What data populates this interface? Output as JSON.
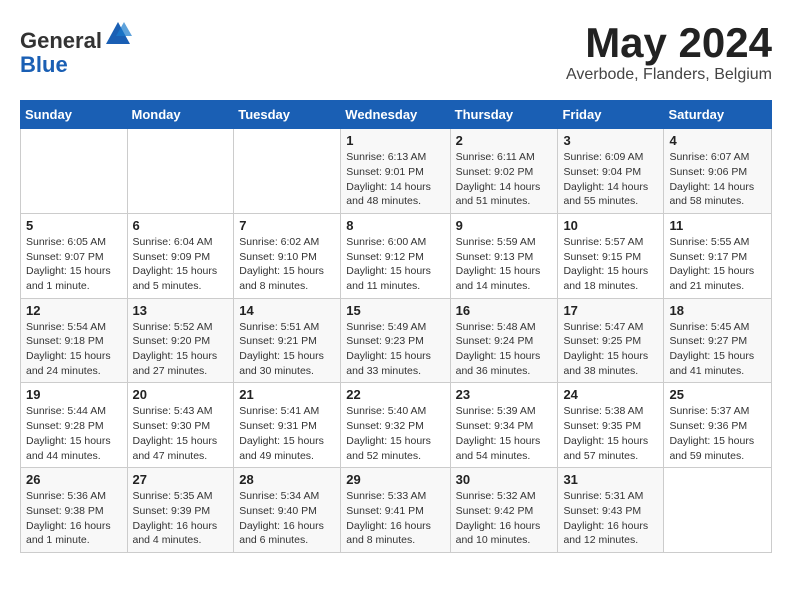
{
  "header": {
    "logo_line1": "General",
    "logo_line2": "Blue",
    "month_title": "May 2024",
    "location": "Averbode, Flanders, Belgium"
  },
  "days_of_week": [
    "Sunday",
    "Monday",
    "Tuesday",
    "Wednesday",
    "Thursday",
    "Friday",
    "Saturday"
  ],
  "weeks": [
    [
      {
        "day": "",
        "info": ""
      },
      {
        "day": "",
        "info": ""
      },
      {
        "day": "",
        "info": ""
      },
      {
        "day": "1",
        "info": "Sunrise: 6:13 AM\nSunset: 9:01 PM\nDaylight: 14 hours\nand 48 minutes."
      },
      {
        "day": "2",
        "info": "Sunrise: 6:11 AM\nSunset: 9:02 PM\nDaylight: 14 hours\nand 51 minutes."
      },
      {
        "day": "3",
        "info": "Sunrise: 6:09 AM\nSunset: 9:04 PM\nDaylight: 14 hours\nand 55 minutes."
      },
      {
        "day": "4",
        "info": "Sunrise: 6:07 AM\nSunset: 9:06 PM\nDaylight: 14 hours\nand 58 minutes."
      }
    ],
    [
      {
        "day": "5",
        "info": "Sunrise: 6:05 AM\nSunset: 9:07 PM\nDaylight: 15 hours\nand 1 minute."
      },
      {
        "day": "6",
        "info": "Sunrise: 6:04 AM\nSunset: 9:09 PM\nDaylight: 15 hours\nand 5 minutes."
      },
      {
        "day": "7",
        "info": "Sunrise: 6:02 AM\nSunset: 9:10 PM\nDaylight: 15 hours\nand 8 minutes."
      },
      {
        "day": "8",
        "info": "Sunrise: 6:00 AM\nSunset: 9:12 PM\nDaylight: 15 hours\nand 11 minutes."
      },
      {
        "day": "9",
        "info": "Sunrise: 5:59 AM\nSunset: 9:13 PM\nDaylight: 15 hours\nand 14 minutes."
      },
      {
        "day": "10",
        "info": "Sunrise: 5:57 AM\nSunset: 9:15 PM\nDaylight: 15 hours\nand 18 minutes."
      },
      {
        "day": "11",
        "info": "Sunrise: 5:55 AM\nSunset: 9:17 PM\nDaylight: 15 hours\nand 21 minutes."
      }
    ],
    [
      {
        "day": "12",
        "info": "Sunrise: 5:54 AM\nSunset: 9:18 PM\nDaylight: 15 hours\nand 24 minutes."
      },
      {
        "day": "13",
        "info": "Sunrise: 5:52 AM\nSunset: 9:20 PM\nDaylight: 15 hours\nand 27 minutes."
      },
      {
        "day": "14",
        "info": "Sunrise: 5:51 AM\nSunset: 9:21 PM\nDaylight: 15 hours\nand 30 minutes."
      },
      {
        "day": "15",
        "info": "Sunrise: 5:49 AM\nSunset: 9:23 PM\nDaylight: 15 hours\nand 33 minutes."
      },
      {
        "day": "16",
        "info": "Sunrise: 5:48 AM\nSunset: 9:24 PM\nDaylight: 15 hours\nand 36 minutes."
      },
      {
        "day": "17",
        "info": "Sunrise: 5:47 AM\nSunset: 9:25 PM\nDaylight: 15 hours\nand 38 minutes."
      },
      {
        "day": "18",
        "info": "Sunrise: 5:45 AM\nSunset: 9:27 PM\nDaylight: 15 hours\nand 41 minutes."
      }
    ],
    [
      {
        "day": "19",
        "info": "Sunrise: 5:44 AM\nSunset: 9:28 PM\nDaylight: 15 hours\nand 44 minutes."
      },
      {
        "day": "20",
        "info": "Sunrise: 5:43 AM\nSunset: 9:30 PM\nDaylight: 15 hours\nand 47 minutes."
      },
      {
        "day": "21",
        "info": "Sunrise: 5:41 AM\nSunset: 9:31 PM\nDaylight: 15 hours\nand 49 minutes."
      },
      {
        "day": "22",
        "info": "Sunrise: 5:40 AM\nSunset: 9:32 PM\nDaylight: 15 hours\nand 52 minutes."
      },
      {
        "day": "23",
        "info": "Sunrise: 5:39 AM\nSunset: 9:34 PM\nDaylight: 15 hours\nand 54 minutes."
      },
      {
        "day": "24",
        "info": "Sunrise: 5:38 AM\nSunset: 9:35 PM\nDaylight: 15 hours\nand 57 minutes."
      },
      {
        "day": "25",
        "info": "Sunrise: 5:37 AM\nSunset: 9:36 PM\nDaylight: 15 hours\nand 59 minutes."
      }
    ],
    [
      {
        "day": "26",
        "info": "Sunrise: 5:36 AM\nSunset: 9:38 PM\nDaylight: 16 hours\nand 1 minute."
      },
      {
        "day": "27",
        "info": "Sunrise: 5:35 AM\nSunset: 9:39 PM\nDaylight: 16 hours\nand 4 minutes."
      },
      {
        "day": "28",
        "info": "Sunrise: 5:34 AM\nSunset: 9:40 PM\nDaylight: 16 hours\nand 6 minutes."
      },
      {
        "day": "29",
        "info": "Sunrise: 5:33 AM\nSunset: 9:41 PM\nDaylight: 16 hours\nand 8 minutes."
      },
      {
        "day": "30",
        "info": "Sunrise: 5:32 AM\nSunset: 9:42 PM\nDaylight: 16 hours\nand 10 minutes."
      },
      {
        "day": "31",
        "info": "Sunrise: 5:31 AM\nSunset: 9:43 PM\nDaylight: 16 hours\nand 12 minutes."
      },
      {
        "day": "",
        "info": ""
      }
    ]
  ]
}
